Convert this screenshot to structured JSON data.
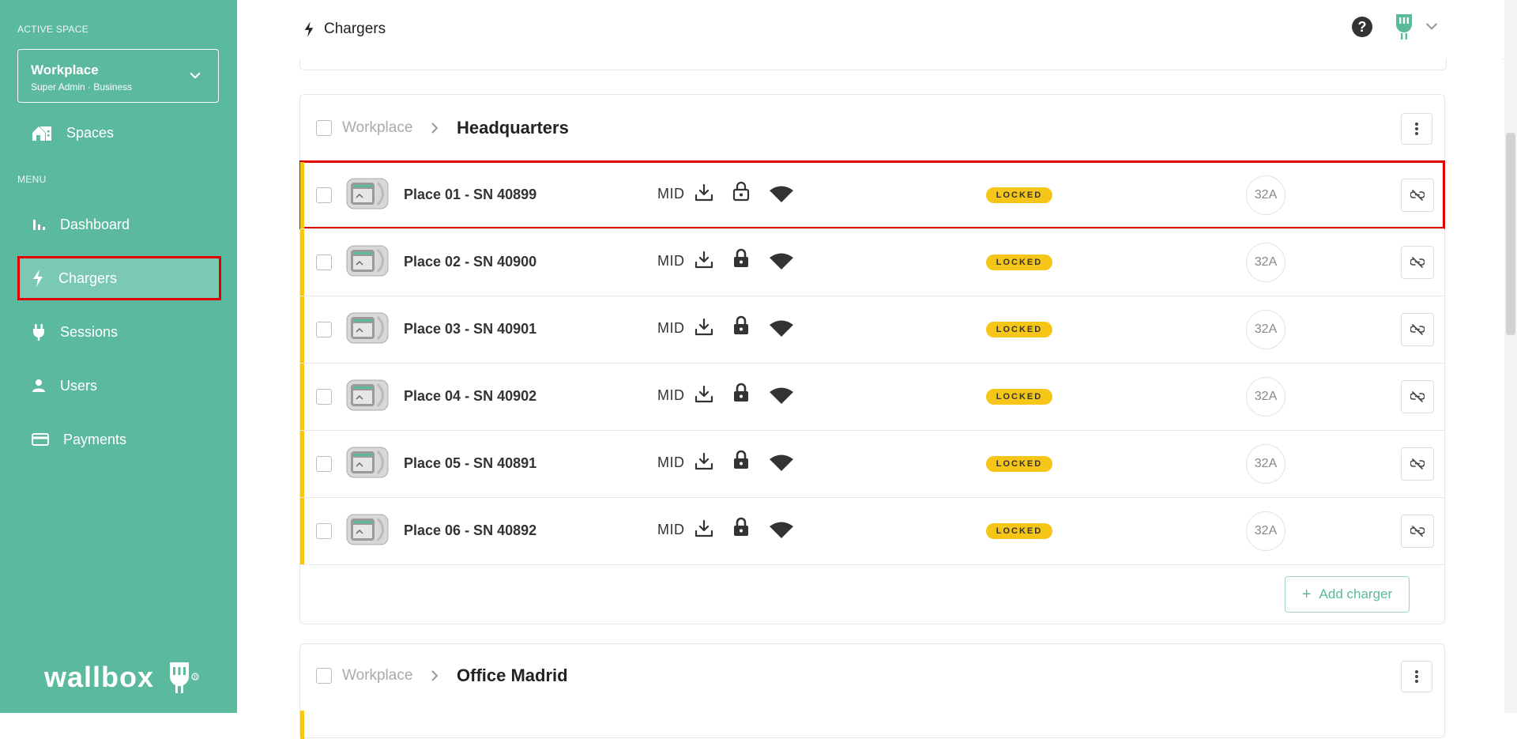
{
  "sidebar": {
    "active_space_caption": "ACTIVE SPACE",
    "space_name": "Workplace",
    "space_role": "Super Admin · Business",
    "spaces_label": "Spaces",
    "menu_caption": "MENU",
    "items": [
      {
        "label": "Dashboard",
        "icon": "bar-chart-icon"
      },
      {
        "label": "Chargers",
        "icon": "bolt-icon",
        "active": true
      },
      {
        "label": "Sessions",
        "icon": "plug-icon"
      },
      {
        "label": "Users",
        "icon": "user-icon"
      },
      {
        "label": "Payments",
        "icon": "credit-card-icon"
      }
    ],
    "logo_text": "wallbox"
  },
  "header": {
    "title": "Chargers"
  },
  "colors": {
    "brand": "#5bb99e",
    "brand_active": "#7bc8b3",
    "locked": "#f5c518",
    "highlight": "#e00000"
  },
  "groups": [
    {
      "root": "Workplace",
      "name": "Headquarters",
      "chargers": [
        {
          "name": "Place 01 - SN 40899",
          "mid": "MID",
          "status": "LOCKED",
          "amps": "32A",
          "selected": true,
          "lock": "outline"
        },
        {
          "name": "Place 02 - SN 40900",
          "mid": "MID",
          "status": "LOCKED",
          "amps": "32A",
          "lock": "filled"
        },
        {
          "name": "Place 03 - SN 40901",
          "mid": "MID",
          "status": "LOCKED",
          "amps": "32A",
          "lock": "filled"
        },
        {
          "name": "Place 04 - SN 40902",
          "mid": "MID",
          "status": "LOCKED",
          "amps": "32A",
          "lock": "filled"
        },
        {
          "name": "Place 05 - SN 40891",
          "mid": "MID",
          "status": "LOCKED",
          "amps": "32A",
          "lock": "filled"
        },
        {
          "name": "Place 06 - SN 40892",
          "mid": "MID",
          "status": "LOCKED",
          "amps": "32A",
          "lock": "filled"
        }
      ],
      "add_label": "Add charger"
    },
    {
      "root": "Workplace",
      "name": "Office Madrid"
    }
  ]
}
